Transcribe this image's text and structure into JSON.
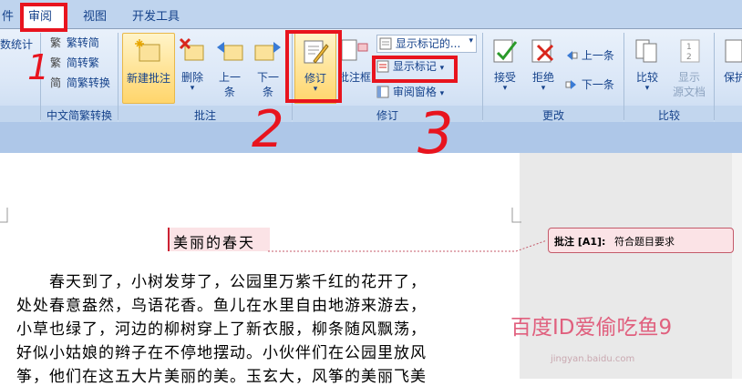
{
  "tabs": {
    "partial_left": "件",
    "review": "审阅",
    "view": "视图",
    "developer": "开发工具"
  },
  "groups": {
    "chinese_conversion": {
      "label": "中文简繁转换",
      "partial_left_label": "数统计",
      "to_simplified": "繁转简",
      "to_traditional": "简转繁",
      "conversion": "简繁转换"
    },
    "comments": {
      "label": "批注",
      "new_comment": "新建批注",
      "delete": "删除",
      "previous_line1": "上一",
      "previous_line2": "条",
      "next_line1": "下一",
      "next_line2": "条"
    },
    "tracking": {
      "label": "修订",
      "track_changes": "修订",
      "balloons": "批注框",
      "display_dropdown": "显示标记的...",
      "show_markup": "显示标记",
      "reviewing_pane": "审阅窗格"
    },
    "changes": {
      "label": "更改",
      "accept": "接受",
      "reject": "拒绝",
      "previous": "上一条",
      "next": "下一条"
    },
    "compare": {
      "label": "比较",
      "compare": "比较",
      "show_source_line1": "显示",
      "show_source_line2": "源文档"
    },
    "protect": {
      "partial_label": "保护"
    }
  },
  "annotations": {
    "num1": "1",
    "num2": "2",
    "num3": "3"
  },
  "document": {
    "title": "美丽的春天",
    "lines": [
      "春天到了，小树发芽了，公园里万紫千红的花开了，",
      "处处春意盎然，鸟语花香。鱼儿在水里自由地游来游去，",
      "小草也绿了，河边的柳树穿上了新衣服，柳条随风飘荡，",
      "好似小姑娘的辫子在不停地摆动。小伙伴们在公园里放风",
      "筝，他们在这五大片美丽的美。玉玄大，风筝的美丽飞美"
    ]
  },
  "comment": {
    "label": "批注 [A1]:",
    "text": "符合题目要求"
  },
  "watermark": {
    "text": "百度ID爱偷吃鱼9",
    "url": "jingyan.baidu.com"
  },
  "colors": {
    "ribbon": "#dbe7f7",
    "tab_text": "#15428b",
    "highlight_red": "#e8141e",
    "comment_fill": "#fbe3e6"
  }
}
